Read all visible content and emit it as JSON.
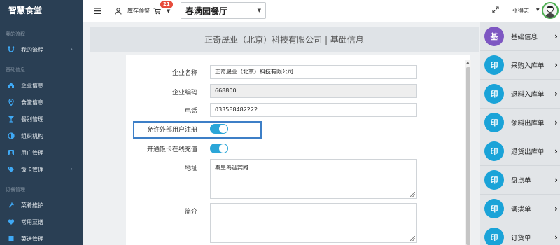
{
  "sidebar": {
    "brand": "智慧食堂",
    "sections": [
      {
        "title": "我的流程",
        "items": [
          {
            "label": "我的流程",
            "icon": "flow-icon",
            "chevron": true
          }
        ]
      },
      {
        "title": "基础信息",
        "items": [
          {
            "label": "企业信息",
            "icon": "home-icon",
            "chevron": false
          },
          {
            "label": "食堂信息",
            "icon": "location-icon",
            "chevron": false
          },
          {
            "label": "餐别管理",
            "icon": "cup-icon",
            "chevron": false
          },
          {
            "label": "组织机构",
            "icon": "org-icon",
            "chevron": false
          },
          {
            "label": "用户管理",
            "icon": "user-icon",
            "chevron": false
          },
          {
            "label": "饭卡管理",
            "icon": "tag-icon",
            "chevron": true
          }
        ]
      },
      {
        "title": "订餐管理",
        "items": [
          {
            "label": "菜肴维护",
            "icon": "tool-icon",
            "chevron": false
          },
          {
            "label": "常用菜谱",
            "icon": "heart-icon",
            "chevron": false
          },
          {
            "label": "菜谱管理",
            "icon": "book-icon",
            "chevron": false
          }
        ]
      }
    ]
  },
  "topbar": {
    "stock_label": "库存预警",
    "stock_badge": "21",
    "restaurant": "春满园餐厅",
    "username": "张得志"
  },
  "page": {
    "header": "正奇晟业（北京）科技有限公司 | 基础信息"
  },
  "form": {
    "company_name": {
      "label": "企业名称",
      "value": "正奇晟业（北京）科技有限公司"
    },
    "company_code": {
      "label": "企业编码",
      "value": "668800"
    },
    "phone": {
      "label": "电话",
      "value": "033588482222"
    },
    "external_register": {
      "label": "允许外部用户注册",
      "checked": true
    },
    "card_recharge": {
      "label": "开通饭卡在线充值",
      "checked": true
    },
    "address": {
      "label": "地址",
      "value": "秦皇岛迎宾路"
    },
    "intro": {
      "label": "简介",
      "value": ""
    }
  },
  "right_panel": {
    "items": [
      {
        "glyph": "基",
        "label": "基础信息",
        "color": "#7e57c2"
      },
      {
        "glyph": "印",
        "label": "采购入库单",
        "color": "#1aa3d8"
      },
      {
        "glyph": "印",
        "label": "退料入库单",
        "color": "#1aa3d8"
      },
      {
        "glyph": "印",
        "label": "领料出库单",
        "color": "#1aa3d8"
      },
      {
        "glyph": "印",
        "label": "退货出库单",
        "color": "#1aa3d8"
      },
      {
        "glyph": "印",
        "label": "盘点单",
        "color": "#1aa3d8"
      },
      {
        "glyph": "印",
        "label": "调拨单",
        "color": "#1aa3d8"
      },
      {
        "glyph": "印",
        "label": "订货单",
        "color": "#1aa3d8"
      }
    ]
  }
}
